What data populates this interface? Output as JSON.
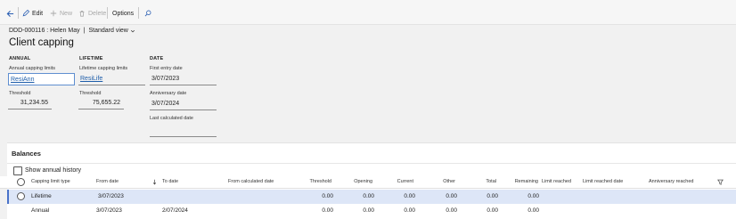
{
  "toolbar": {
    "edit_label": "Edit",
    "new_label": "New",
    "delete_label": "Delete",
    "options_label": "Options"
  },
  "header": {
    "record": "DDD-000116 : Helen May",
    "separator": "|",
    "view": "Standard view",
    "title": "Client capping"
  },
  "groups": {
    "annual": {
      "title": "ANNUAL",
      "limits_label": "Annual capping limits",
      "limits_value": "ResiAnn",
      "threshold_label": "Threshold",
      "threshold_value": "31,234.55"
    },
    "lifetime": {
      "title": "LIFETIME",
      "limits_label": "Lifetime capping limits",
      "limits_value": "ResiLife",
      "threshold_label": "Threshold",
      "threshold_value": "75,655.22"
    },
    "date": {
      "title": "DATE",
      "first_entry_label": "First entry date",
      "first_entry_value": "3/07/2023",
      "anniversary_label": "Anniversary date",
      "anniversary_value": "3/07/2024",
      "last_calc_label": "Last calculated date",
      "last_calc_value": ""
    }
  },
  "balances": {
    "title": "Balances",
    "show_history_label": "Show annual history",
    "columns": {
      "type": "Capping limit type",
      "from": "From date",
      "to": "To date",
      "from_calc": "From calculated date",
      "threshold": "Threshold",
      "opening": "Opening",
      "current": "Current",
      "other": "Other",
      "total": "Total",
      "remaining": "Remaining",
      "limit_reached": "Limit reached",
      "limit_reached_date": "Limit reached date",
      "anniversary_reached": "Anniversary reached"
    },
    "rows": [
      {
        "type": "Lifetime",
        "from": "3/07/2023",
        "to": "",
        "threshold": "0.00",
        "opening": "0.00",
        "current": "0.00",
        "other": "0.00",
        "total": "0.00",
        "remaining": "0.00"
      },
      {
        "type": "Annual",
        "from": "3/07/2023",
        "to": "2/07/2024",
        "threshold": "0.00",
        "opening": "0.00",
        "current": "0.00",
        "other": "0.00",
        "total": "0.00",
        "remaining": "0.00"
      }
    ]
  }
}
